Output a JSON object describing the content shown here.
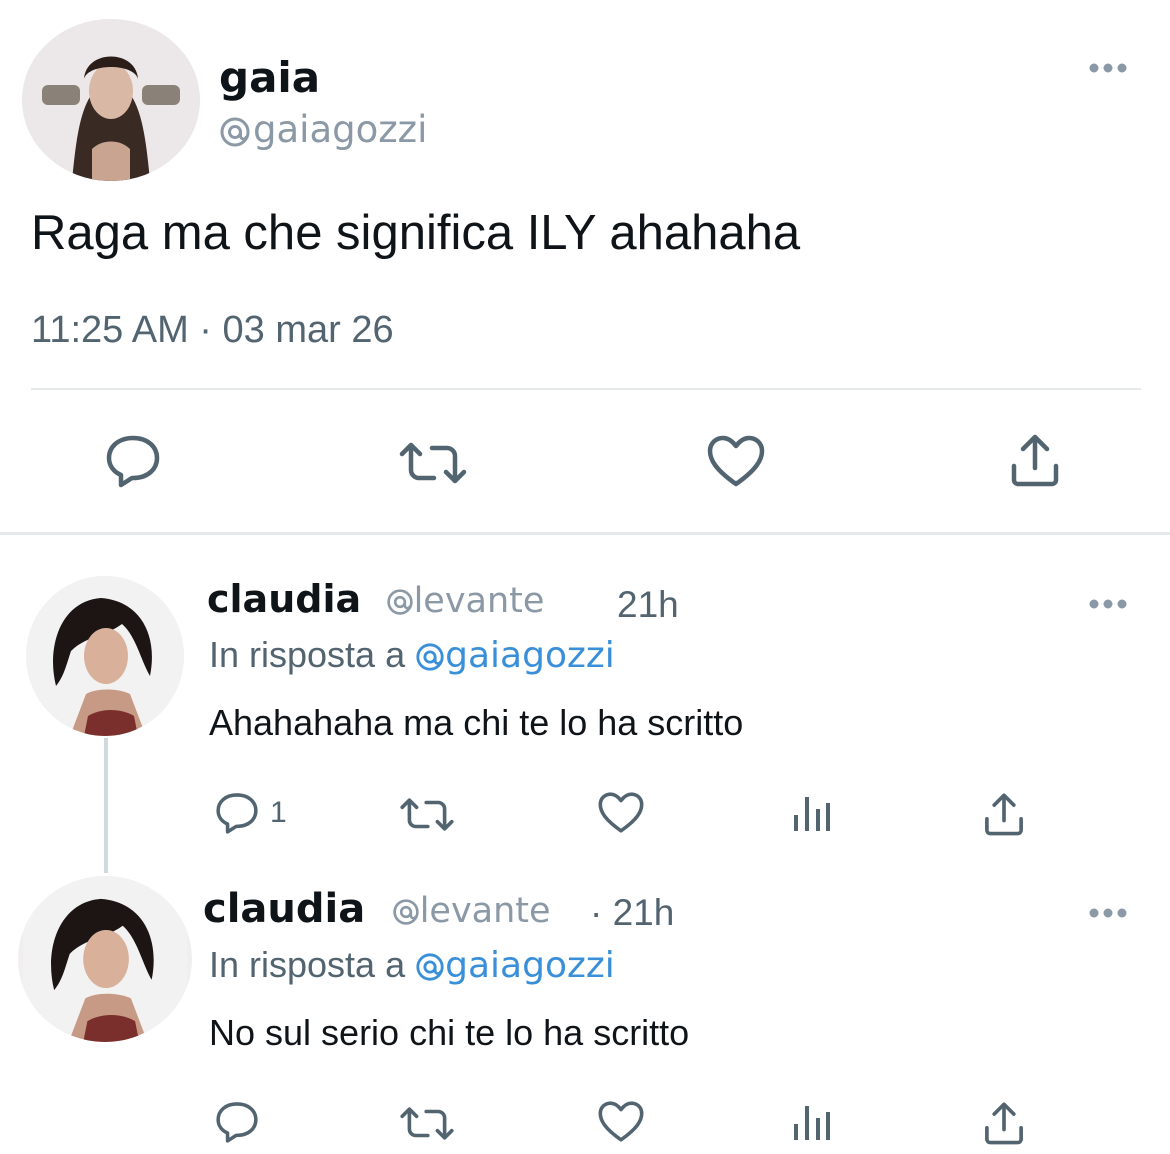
{
  "main_post": {
    "author_name": "gaia",
    "author_handle": "gaiagozzi",
    "text": "Raga ma che significa ILY ahahaha",
    "timestamp": "11:25 AM · 03 mar 26"
  },
  "replies": [
    {
      "author_name": "claudia",
      "author_handle": "levante",
      "separator": "",
      "time": "21h",
      "reply_prefix": "In risposta a",
      "reply_to": "gaiagozzi",
      "text": "Ahahahaha ma chi te lo ha scritto",
      "reply_count": "1"
    },
    {
      "author_name": "claudia",
      "author_handle": "levante",
      "separator": "·",
      "time": "21h",
      "reply_prefix": "In risposta a",
      "reply_to": "gaiagozzi",
      "text": "No sul serio chi te lo ha scritto",
      "reply_count": ""
    }
  ],
  "icons": {
    "reply": "speech-bubble-icon",
    "repost": "repost-icon",
    "like": "heart-icon",
    "views": "bar-chart-icon",
    "share": "share-upload-icon",
    "more": "more-dots-icon",
    "handle_prefix": "threads-at-icon"
  },
  "colors": {
    "text": "#0f1419",
    "secondary": "#536471",
    "link": "#3a8fd9",
    "divider": "#e6e9ec"
  }
}
